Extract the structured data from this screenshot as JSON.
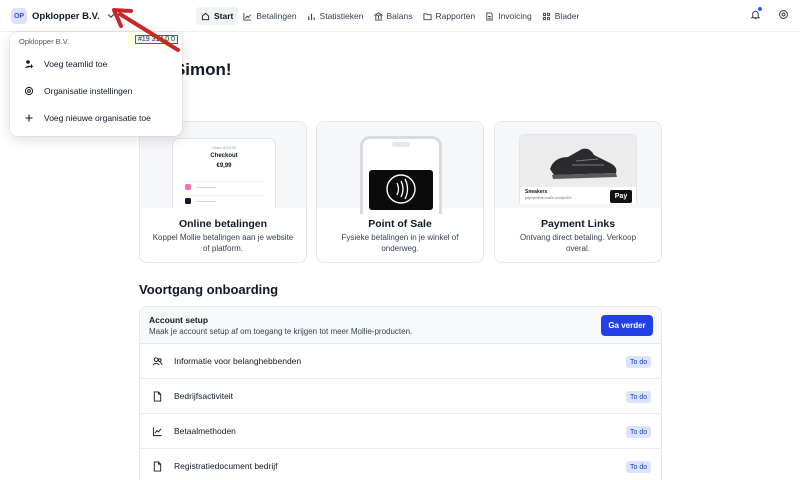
{
  "org": {
    "initials": "OP",
    "name": "Opklopper B.V."
  },
  "nav": [
    {
      "label": "Start",
      "icon": "home-icon",
      "active": true
    },
    {
      "label": "Betalingen",
      "icon": "trend-icon"
    },
    {
      "label": "Statistieken",
      "icon": "bar-chart-icon"
    },
    {
      "label": "Balans",
      "icon": "bank-icon"
    },
    {
      "label": "Rapporten",
      "icon": "folder-icon"
    },
    {
      "label": "Invoicing",
      "icon": "document-icon"
    },
    {
      "label": "Blader",
      "icon": "grid-icon"
    }
  ],
  "dropdown": {
    "header": "Opklopper B.V.",
    "org_id": "#19 314 0 0",
    "items": [
      {
        "label": "Voeg teamlid toe",
        "icon": "add-user-icon"
      },
      {
        "label": "Organisatie instellingen",
        "icon": "settings-icon"
      },
      {
        "label": "Voeg nieuwe organisatie toe",
        "icon": "plus-icon"
      }
    ]
  },
  "welcome": "om, Simon!",
  "cards": [
    {
      "title": "Online betalingen",
      "desc": "Koppel Mollie betalingen aan je website of platform.",
      "mock": {
        "small": "Order #00150",
        "head": "Checkout",
        "amount": "€9,99"
      }
    },
    {
      "title": "Point of Sale",
      "desc": "Fysieke betalingen in je winkel of onderweg."
    },
    {
      "title": "Payment Links",
      "desc": "Ontvang direct betaling. Verkoop overal.",
      "mock": {
        "name": "Sneakers",
        "url": "paymentlink.mollie.com/p/xDh",
        "badge": "Pay"
      }
    }
  ],
  "onboarding": {
    "title": "Voortgang onboarding",
    "setup_title": "Account setup",
    "setup_sub": "Maak je account setup af om toegang te krijgen tot meer Mollie-producten.",
    "cta": "Ga verder",
    "rows": [
      {
        "label": "Informatie voor belanghebbenden",
        "icon": "people-icon",
        "status": "To do"
      },
      {
        "label": "Bedrijfsactiviteit",
        "icon": "document-icon",
        "status": "To do"
      },
      {
        "label": "Betaalmethoden",
        "icon": "trend-icon",
        "status": "To do"
      },
      {
        "label": "Registratiedocument bedrijf",
        "icon": "document-icon",
        "status": "To do"
      }
    ]
  },
  "colors": {
    "primary": "#2340e6",
    "badge_bg": "#dbe4fb",
    "annotation": "#c62828"
  }
}
